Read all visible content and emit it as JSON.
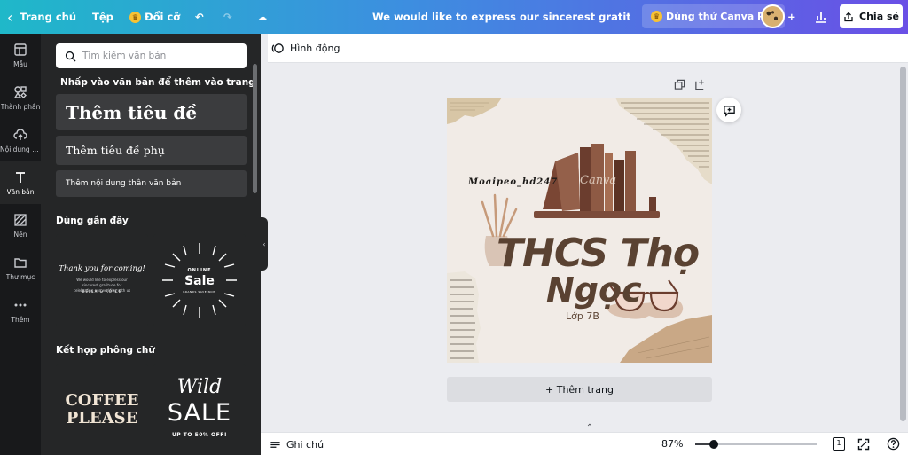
{
  "topbar": {
    "home_label": "Trang chủ",
    "file_label": "Tệp",
    "resize_label": "Đổi cỡ",
    "doc_title": "We would like to express our sincerest gratitude for celebr...",
    "try_pro_label": "Dùng thử Canva Pro",
    "share_label": "Chia sẻ"
  },
  "rail": {
    "items": [
      {
        "label": "Mẫu",
        "icon": "template-icon"
      },
      {
        "label": "Thành phần",
        "icon": "elements-icon"
      },
      {
        "label": "Nội dung tải lên",
        "icon": "upload-icon"
      },
      {
        "label": "Văn bản",
        "icon": "text-icon",
        "active": true
      },
      {
        "label": "Nền",
        "icon": "background-icon"
      },
      {
        "label": "Thư mục",
        "icon": "folder-icon"
      },
      {
        "label": "Thêm",
        "icon": "more-icon"
      }
    ]
  },
  "panel": {
    "search_placeholder": "Tìm kiếm văn bản",
    "click_hint": "Nhấp vào văn bản để thêm vào trang",
    "add_heading": "Thêm tiêu đề",
    "add_subheading": "Thêm tiêu đề phụ",
    "add_body": "Thêm nội dung thân văn bản",
    "recent_header": "Dùng gần đây",
    "combo_header": "Kết hợp phông chữ",
    "recent": [
      {
        "line1": "Thank you for coming!",
        "line2": "We would like to express our sincerest gratitude for celebrating our wedding with us",
        "line3": "BELLA & ROYCE"
      },
      {
        "line1": "ONLINE",
        "line2": "Sale",
        "line3": "BRANDS SAVE NOW"
      }
    ],
    "combos": [
      {
        "line1": "COFFEE",
        "line2": "PLEASE"
      },
      {
        "line1": "Wild",
        "line2": "SALE",
        "line3": "UP TO 50% OFF!"
      }
    ]
  },
  "toolbar": {
    "animate_label": "Hình động"
  },
  "design": {
    "handle": "Moaipeo_hd247",
    "watermark": "Canva",
    "title_line1": "THCS Thọ",
    "title_line2": "Ngọc",
    "class_label": "Lớp 7B",
    "bg_color": "#f1ebe6"
  },
  "canvas": {
    "add_page_label": "+ Thêm trang"
  },
  "bottombar": {
    "notes_label": "Ghi chú",
    "zoom_label": "87%",
    "zoom_level": 0.15,
    "page_count": "1"
  }
}
